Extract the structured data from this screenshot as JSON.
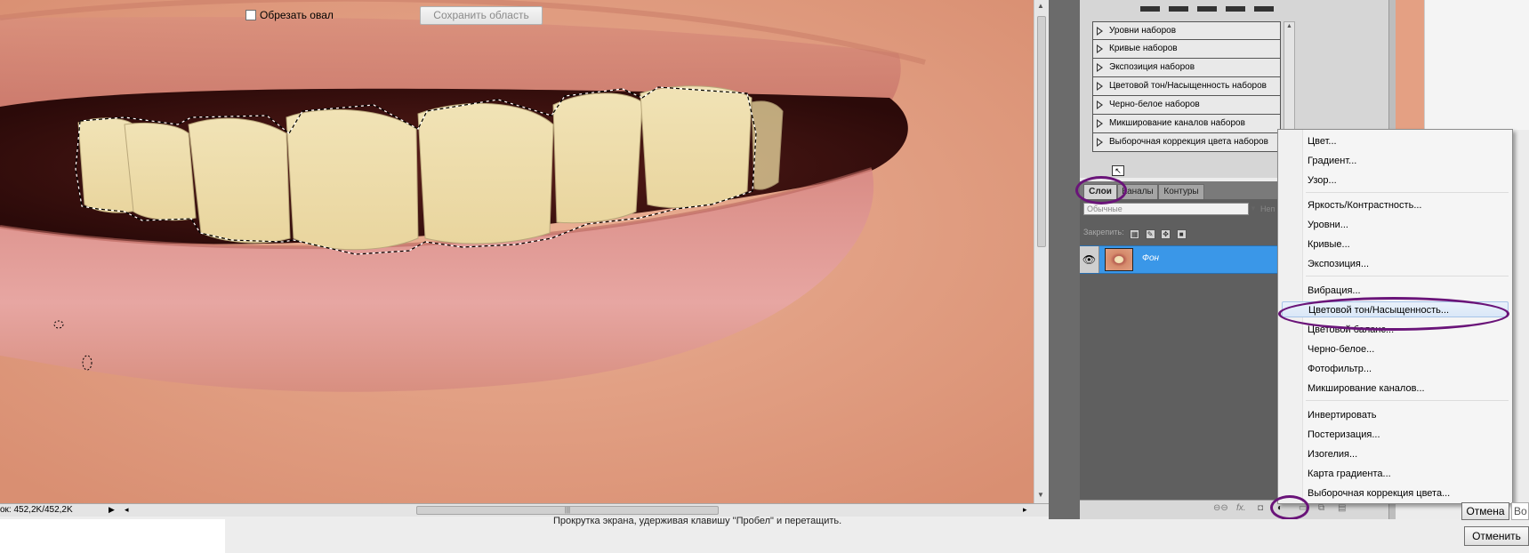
{
  "canvas": {
    "status_info": "ок: 452,2K/452,2K"
  },
  "adjustments": {
    "presets": [
      "Уровни наборов",
      "Кривые наборов",
      "Экспозиция наборов",
      "Цветовой тон/Насыщенность наборов",
      "Черно-белое наборов",
      "Микширование каналов наборов",
      "Выборочная коррекция цвета наборов"
    ]
  },
  "layers": {
    "tabs": [
      "Слои",
      "Каналы",
      "Контуры"
    ],
    "blend_mode": "Обычные",
    "opacity_label": "Неп",
    "lock_label": "Закрепить:",
    "layer_name": "Фон"
  },
  "menu": {
    "items": [
      "Цвет...",
      "Градиент...",
      "Узор...",
      "Яркость/Контрастность...",
      "Уровни...",
      "Кривые...",
      "Экспозиция...",
      "Вибрация...",
      "Цветовой тон/Насыщенность...",
      "Цветовой баланс...",
      "Черно-белое...",
      "Фотофильтр...",
      "Микширование каналов...",
      "Инвертировать",
      "Постеризация...",
      "Изогелия...",
      "Карта градиента...",
      "Выборочная коррекция цвета..."
    ],
    "highlighted": "Цветовой тон/Насыщенность..."
  },
  "dialog": {
    "crop_oval_label": "Обрезать овал",
    "save_area_label": "Сохранить область",
    "hint": "Прокрутка экрана, удерживая клавишу \"Пробел\" и перетащить.",
    "cancel_label_1": "Отмена",
    "cancel_label_2": "Отменить",
    "side_field": "Во"
  },
  "colors": {
    "callout": "#6a1479",
    "layer_selected": "#3a97e8",
    "menu_highlight": "#dae7f7"
  }
}
